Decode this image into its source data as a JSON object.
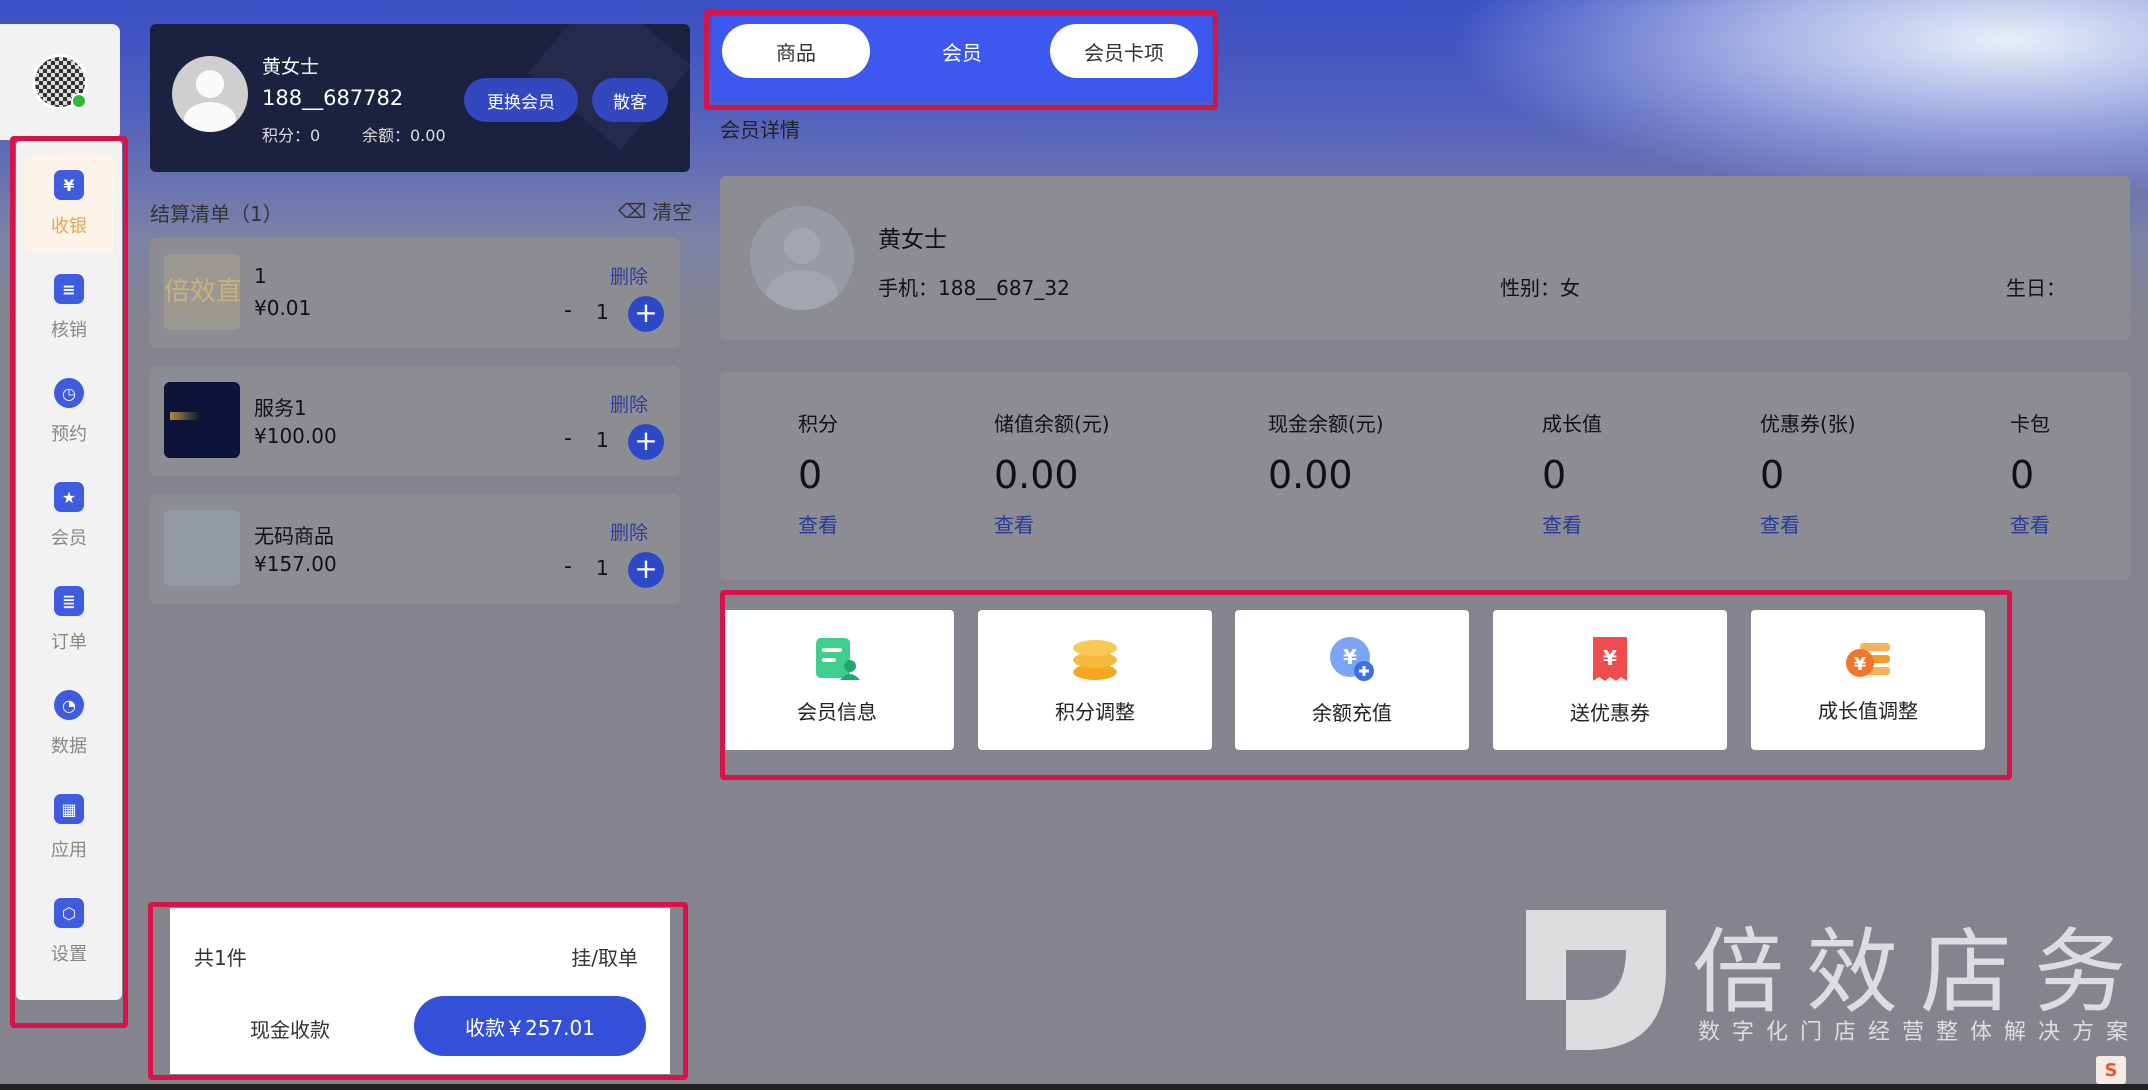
{
  "sidebar": {
    "items": [
      {
        "label": "收银",
        "icon": "cashier-icon",
        "glyph": "¥",
        "active": true
      },
      {
        "label": "核销",
        "icon": "verify-icon",
        "glyph": "≡",
        "active": false
      },
      {
        "label": "预约",
        "icon": "clock-icon",
        "glyph": "◷",
        "active": false
      },
      {
        "label": "会员",
        "icon": "member-icon",
        "glyph": "★",
        "active": false
      },
      {
        "label": "订单",
        "icon": "order-icon",
        "glyph": "≣",
        "active": false
      },
      {
        "label": "数据",
        "icon": "pie-chart-icon",
        "glyph": "◔",
        "active": false
      },
      {
        "label": "应用",
        "icon": "apps-icon",
        "glyph": "▦",
        "active": false
      },
      {
        "label": "设置",
        "icon": "settings-icon",
        "glyph": "⬡",
        "active": false
      }
    ]
  },
  "member_header": {
    "name": "黄女士",
    "phone": "188__687782",
    "points": "积分：0",
    "balance": "余额：0.00",
    "change_member_label": "更换会员",
    "guest_label": "散客"
  },
  "checkout": {
    "title": "结算清单（1）",
    "clear_label": "清空",
    "items": [
      {
        "name": "1",
        "price": "¥0.01",
        "delete_label": "删除",
        "qty": "1",
        "thumb_text": "倍效直"
      },
      {
        "name": "服务1",
        "price": "¥100.00",
        "delete_label": "删除",
        "qty": "1"
      },
      {
        "name": "无码商品",
        "price": "¥157.00",
        "delete_label": "删除",
        "qty": "1"
      }
    ],
    "minus": "-",
    "plus": "+",
    "total_count": "共1件",
    "hang_order": "挂/取单",
    "cash_pay": "现金收款",
    "pay_button": "收款￥257.01"
  },
  "tabs": [
    {
      "label": "商品"
    },
    {
      "label": "会员"
    },
    {
      "label": "会员卡项"
    }
  ],
  "detail": {
    "section_title": "会员详情",
    "name": "黄女士",
    "phone": "手机：188__687_32",
    "gender": "性别：女",
    "birthday": "生日："
  },
  "stats": [
    {
      "label": "积分",
      "value": "0",
      "link": "查看"
    },
    {
      "label": "储值余额(元)",
      "value": "0.00",
      "link": "查看"
    },
    {
      "label": "现金余额(元)",
      "value": "0.00",
      "link": ""
    },
    {
      "label": "成长值",
      "value": "0",
      "link": "查看"
    },
    {
      "label": "优惠券(张)",
      "value": "0",
      "link": "查看"
    },
    {
      "label": "卡包",
      "value": "0",
      "link": "查看"
    }
  ],
  "actions": [
    {
      "label": "会员信息",
      "icon": "member-info-icon",
      "color": "#3ccf8e"
    },
    {
      "label": "积分调整",
      "icon": "points-coins-icon",
      "color": "#f5b334"
    },
    {
      "label": "余额充值",
      "icon": "recharge-icon",
      "color": "#4c7ef0"
    },
    {
      "label": "送优惠券",
      "icon": "coupon-icon",
      "color": "#f04c4c"
    },
    {
      "label": "成长值调整",
      "icon": "growth-icon",
      "color": "#f59a2c"
    }
  ],
  "watermark": {
    "title": "倍效店务",
    "subtitle": "数字化门店经营整体解决方案"
  },
  "colors": {
    "accent": "#3450d8",
    "highlight_frame": "#d8134a",
    "active_nav": "#e3a94c"
  }
}
